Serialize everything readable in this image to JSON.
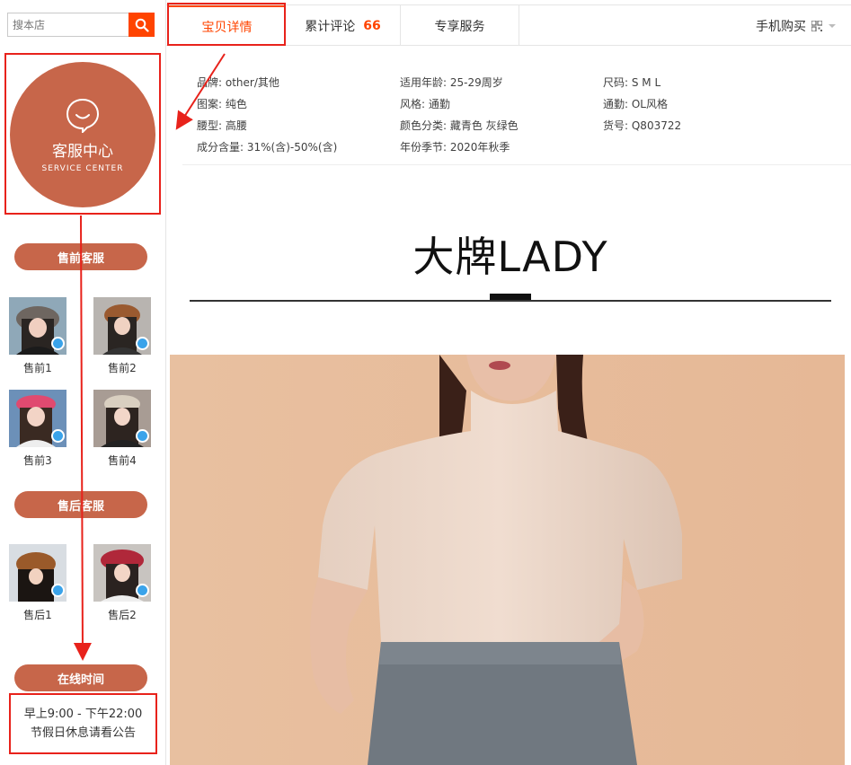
{
  "search": {
    "placeholder": "搜本店"
  },
  "service": {
    "title": "客服中心",
    "subtitle": "SERVICE CENTER"
  },
  "presale": {
    "heading": "售前客服",
    "agents": [
      {
        "name": "售前1"
      },
      {
        "name": "售前2"
      },
      {
        "name": "售前3"
      },
      {
        "name": "售前4"
      }
    ]
  },
  "aftersale": {
    "heading": "售后客服",
    "agents": [
      {
        "name": "售后1"
      },
      {
        "name": "售后2"
      }
    ]
  },
  "online": {
    "heading": "在线时间",
    "hours": "早上9:00 - 下午22:00",
    "note": "节假日休息请看公告"
  },
  "tabs": [
    {
      "label": "宝贝详情"
    },
    {
      "label": "累计评论",
      "count": "66"
    },
    {
      "label": "专享服务"
    }
  ],
  "mobile_buy": "手机购买",
  "attributes": [
    "品牌: other/其他",
    "适用年龄: 25-29周岁",
    "尺码: S M L",
    "图案: 纯色",
    "风格: 通勤",
    "通勤: OL风格",
    "腰型: 高腰",
    "颜色分类: 藏青色 灰绿色",
    "货号: Q803722",
    "成分含量: 31%(含)-50%(含)",
    "年份季节: 2020年秋季"
  ],
  "brand_heading": "大牌LADY",
  "colors": {
    "accent": "#ff4400",
    "service": "#c7664a",
    "annotation": "#e8221b"
  }
}
